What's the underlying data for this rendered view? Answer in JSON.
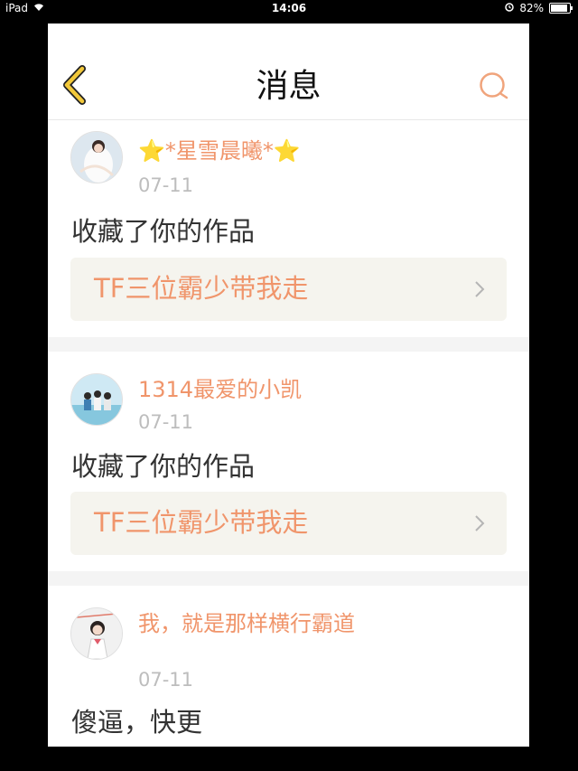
{
  "status_bar": {
    "device": "iPad",
    "time": "14:06",
    "battery": "82%",
    "battery_level": 0.82
  },
  "header": {
    "title": "消息",
    "back_icon": "chevron-left-icon",
    "search_icon": "search-icon"
  },
  "messages": [
    {
      "username": "⭐*星雪晨曦*⭐",
      "date": "07-11",
      "action": "收藏了你的作品",
      "work_title": "TF三位霸少带我走"
    },
    {
      "username": "1314最爱的小凯",
      "date": "07-11",
      "action": "收藏了你的作品",
      "work_title": "TF三位霸少带我走"
    },
    {
      "username": "我，就是那样横行霸道",
      "date": "07-11",
      "action": "傻逼，快更"
    }
  ],
  "colors": {
    "accent": "#f0956b",
    "back_arrow": "#e8b52a",
    "work_bg": "#f5f4ee"
  }
}
